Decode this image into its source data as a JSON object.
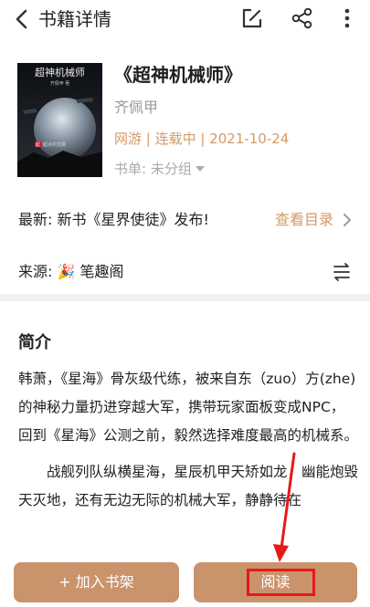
{
  "header": {
    "title": "书籍详情",
    "icons": [
      "back-arrow-icon",
      "edit-icon",
      "share-icon",
      "more-vertical-icon"
    ]
  },
  "book": {
    "title": "《超神机械师》",
    "author": "齐佩甲",
    "meta": "网游 | 连载中 | 2021-10-24",
    "shelf": "书单: 未分组",
    "cover": {
      "title": "超神机械师",
      "author": "齐佩甲 著",
      "publisher": "起点中文网",
      "publisher_badge": "起"
    }
  },
  "latest": {
    "label": "最新: 新书《星界使徒》发布!",
    "link": "查看目录"
  },
  "source": {
    "label": "来源: 🎉 笔趣阁"
  },
  "intro": {
    "heading": "简介",
    "paragraphs": [
      "韩萧，《星海》骨灰级代练，被来自东（zuo）方(zhe)的神秘力量扔进穿越大军，携带玩家面板变成NPC，回到《星海》公测之前，毅然选择难度最高的机械系。",
      "战舰列队纵横星海，星辰机甲天矫如龙，幽能炮毁天灭地，还有无边无际的机械大军，静静待在"
    ]
  },
  "actions": {
    "add_shelf": "+ 加入书架",
    "read": "阅读"
  },
  "colors": {
    "accent": "#c9936c",
    "link": "#d39a66",
    "annotation": "#e81818"
  }
}
